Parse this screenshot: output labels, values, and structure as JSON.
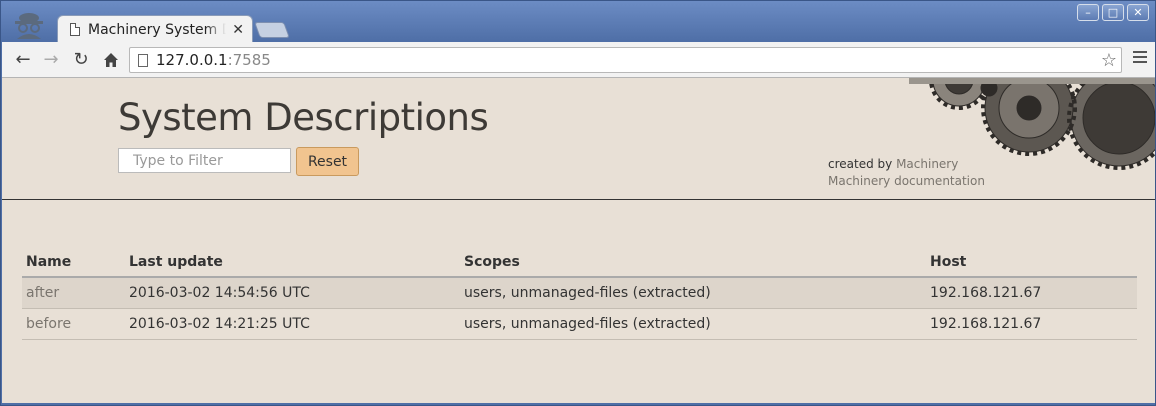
{
  "browser": {
    "tab_title": "Machinery System Descriptions",
    "url_host": "127.0.0.1",
    "url_port": ":7585",
    "tab_close": "✕"
  },
  "header": {
    "title": "System Descriptions",
    "filter_placeholder": "Type to Filter",
    "reset_label": "Reset",
    "created_by_prefix": "created by",
    "created_by_link": "Machinery",
    "docs_link": "Machinery documentation"
  },
  "table": {
    "columns": [
      "Name",
      "Last update",
      "Scopes",
      "Host"
    ],
    "rows": [
      {
        "name": "after",
        "last_update": "2016-03-02 14:54:56 UTC",
        "scopes": "users, unmanaged-files (extracted)",
        "host": "192.168.121.67"
      },
      {
        "name": "before",
        "last_update": "2016-03-02 14:21:25 UTC",
        "scopes": "users, unmanaged-files (extracted)",
        "host": "192.168.121.67"
      }
    ]
  },
  "colors": {
    "page_bg": "#e8e0d6",
    "accent_button": "#f1c48f",
    "window_frame": "#4f6fa7"
  }
}
